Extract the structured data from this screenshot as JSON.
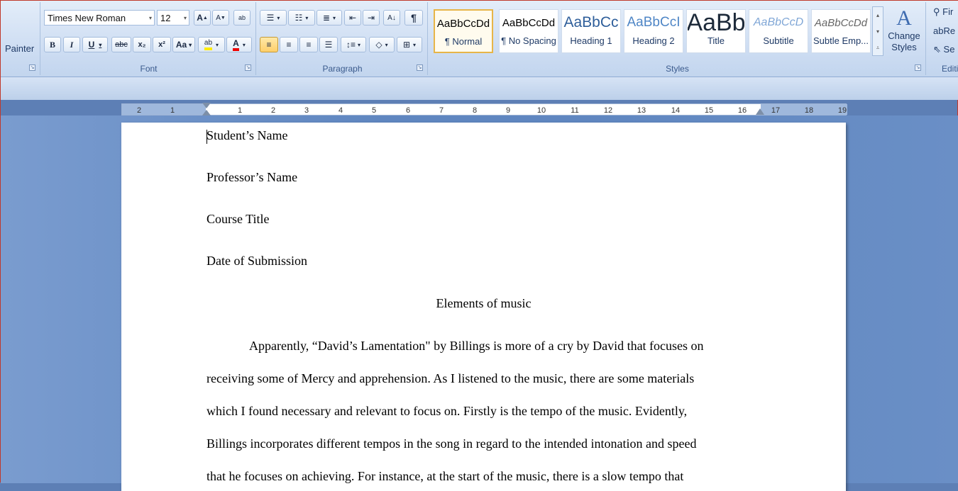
{
  "clipboard": {
    "painter_label": "Painter"
  },
  "font": {
    "family": "Times New Roman",
    "size": "12",
    "label": "Font",
    "grow": "A",
    "shrink": "A",
    "clear": "ab",
    "bold": "B",
    "italic": "I",
    "underline": "U",
    "strike": "abc",
    "subscript": "x₂",
    "superscript": "x²",
    "case": "Aa",
    "highlight": "ab",
    "color": "A"
  },
  "paragraph": {
    "label": "Paragraph"
  },
  "styles": {
    "label": "Styles",
    "change_styles": "Change Styles",
    "items": [
      {
        "sample": "AaBbCcDd",
        "name": "¶ Normal"
      },
      {
        "sample": "AaBbCcDd",
        "name": "¶ No Spacing"
      },
      {
        "sample": "AaBbCc",
        "name": "Heading 1"
      },
      {
        "sample": "AaBbCcI",
        "name": "Heading 2"
      },
      {
        "sample": "AaBb",
        "name": "Title"
      },
      {
        "sample": "AaBbCcD",
        "name": "Subtitle"
      },
      {
        "sample": "AaBbCcDd",
        "name": "Subtle Emp..."
      }
    ]
  },
  "editing": {
    "label": "Editi",
    "find": "Fir",
    "replace": "Re",
    "select": "Se"
  },
  "ruler": {
    "left_labels": [
      "2",
      "1"
    ],
    "right_labels": [
      "1",
      "2",
      "3",
      "4",
      "5",
      "6",
      "7",
      "8",
      "9",
      "10",
      "11",
      "12",
      "13",
      "14",
      "15",
      "16",
      "17",
      "18",
      "19"
    ]
  },
  "document": {
    "lines": [
      "Student’s Name",
      "Professor’s Name",
      "Course Title",
      "Date of Submission",
      "Elements of music",
      "Apparently, “David’s Lamentation\" by Billings is more of a cry by David that focuses on",
      "receiving some of Mercy and apprehension. As I listened to the music, there are some materials",
      "which I found necessary and relevant to focus on. Firstly is the tempo of the music. Evidently,",
      "Billings incorporates different tempos in the song in regard to the intended intonation and speed",
      "that he focuses on achieving. For instance, at the start of the music, there is a slow tempo that"
    ]
  }
}
